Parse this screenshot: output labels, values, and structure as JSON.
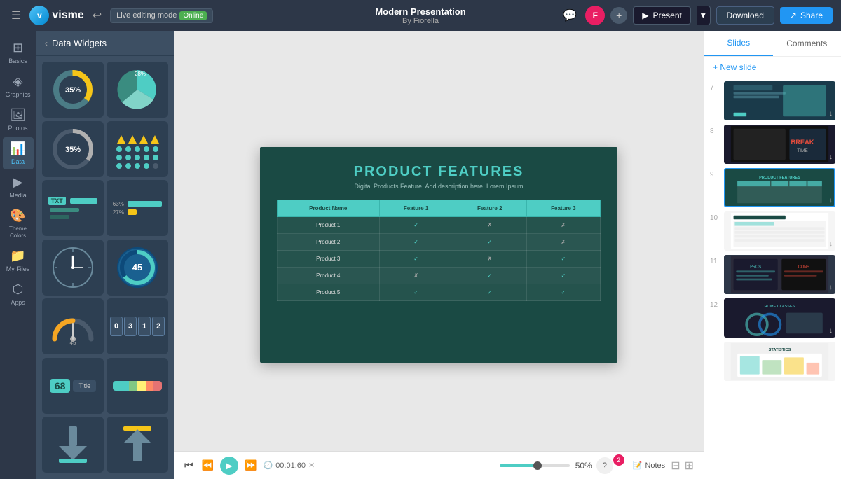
{
  "topbar": {
    "title": "Modern Presentation",
    "subtitle": "By Fiorella",
    "editing_mode": "Live editing mode",
    "online_label": "Online",
    "present_label": "Present",
    "download_label": "Download",
    "share_label": "Share",
    "avatar_initials": "F"
  },
  "widgets_panel": {
    "title": "Data Widgets",
    "back_label": "back"
  },
  "widgets": [
    {
      "id": "w1",
      "type": "donut",
      "value": "35%"
    },
    {
      "id": "w2",
      "type": "pie_green"
    },
    {
      "id": "w3",
      "type": "ring",
      "value": "35%"
    },
    {
      "id": "w4",
      "type": "dots"
    },
    {
      "id": "w5",
      "type": "progress_text"
    },
    {
      "id": "w6",
      "type": "progress_multi"
    },
    {
      "id": "w7",
      "type": "clock"
    },
    {
      "id": "w8",
      "type": "gauge_blue",
      "value": "45"
    },
    {
      "id": "w9",
      "type": "gauge_needle"
    },
    {
      "id": "w10",
      "type": "counter"
    },
    {
      "id": "w11",
      "type": "number_badge"
    },
    {
      "id": "w12",
      "type": "color_bars"
    },
    {
      "id": "w13",
      "type": "down_arrow"
    },
    {
      "id": "w14",
      "type": "upload_arrow"
    }
  ],
  "slide": {
    "title": "PRODUCT FEATURES",
    "subtitle": "Digital Products Feature. Add description here. Lorem Ipsum",
    "table": {
      "headers": [
        "Product Name",
        "Feature 1",
        "Feature 2",
        "Feature 3"
      ],
      "rows": [
        [
          "Product 1",
          "✓",
          "✗",
          "✗"
        ],
        [
          "Product 2",
          "✓",
          "✓",
          "✗"
        ],
        [
          "Product 3",
          "✓",
          "✗",
          "✓"
        ],
        [
          "Product 4",
          "✗",
          "✓",
          "✓"
        ],
        [
          "Product 5",
          "✓",
          "✓",
          "✓"
        ]
      ]
    }
  },
  "playback": {
    "time": "00:01:60"
  },
  "zoom": {
    "value": "50%"
  },
  "notification": {
    "count": "2"
  },
  "notes_label": "Notes",
  "tabs": {
    "slides": "Slides",
    "comments": "Comments"
  },
  "new_slide": "+ New slide",
  "slide_numbers": [
    "7",
    "8",
    "9",
    "10",
    "11",
    "12"
  ],
  "tools": [
    {
      "id": "basics",
      "icon": "⊞",
      "label": "Basics"
    },
    {
      "id": "graphics",
      "icon": "◈",
      "label": "Graphics"
    },
    {
      "id": "photos",
      "icon": "🖼",
      "label": "Photos"
    },
    {
      "id": "data",
      "icon": "📊",
      "label": "Data"
    },
    {
      "id": "media",
      "icon": "▶",
      "label": "Media"
    },
    {
      "id": "theme",
      "icon": "🎨",
      "label": "Theme Colors"
    },
    {
      "id": "myfiles",
      "icon": "📁",
      "label": "My Files"
    },
    {
      "id": "apps",
      "icon": "⬡",
      "label": "Apps"
    }
  ]
}
